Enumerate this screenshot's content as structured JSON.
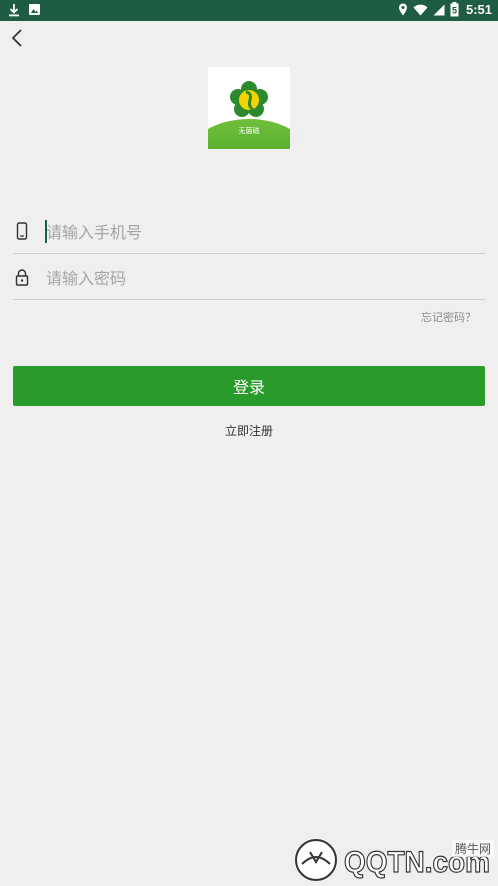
{
  "status_bar": {
    "time": "5:51",
    "battery_level": "5"
  },
  "back_icon": "chevron-left-icon",
  "logo_text": "无菌磁",
  "form": {
    "phone_placeholder": "请输入手机号",
    "password_placeholder": "请输入密码",
    "forgot_label": "忘记密码？",
    "login_label": "登录",
    "register_label": "立即注册"
  },
  "watermark": {
    "text": "QQTN.com",
    "badge": "腾牛网"
  },
  "colors": {
    "status_bar": "#1e5c44",
    "primary": "#2a9a2a",
    "background": "#efefef"
  }
}
